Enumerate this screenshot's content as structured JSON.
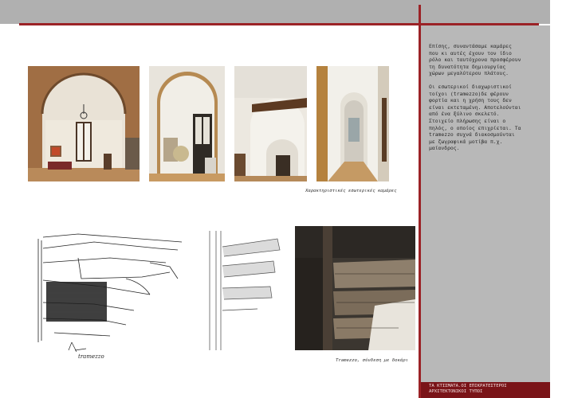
{
  "sidebar": {
    "paragraph1": "Επίσης, συναντάσαμε καμάρες\nπου κι αυτές έχουν τον ίδιο\nρόλο και ταυτόχρονα προσφέρουν\nτη δυνατότητα δημιουργίας\nχώρων μεγαλύτερου πλάτους.",
    "paragraph2": "Οι εσωτερικοί διαχωριστικοί\nτοίχοι (tramezzo)δε φέρουν\nφορτία και η χρήση τους δεν\nείναι εκτεταμένη. Αποτελούνται\nαπό ένα ξύλινο σκελετό.\nΣτοιχείο πλήρωσης είναι ο\nπηλός, ο οποίος επιχρίεται. Τα\ntramezzo συχνά διακοσμούνται\nμε ζωγραφικά μοτίβα π.χ.\nμαίανδρος.",
    "footer": "ΤΑ ΚΤΙΣΜΑΤΑ.ΟΙ ΕΠΙΚΡΑΤΕΣΤΕΡΟΙ\nΑΡΧΙΤΕΚΤΟΝΙΚΟΙ ΤΥΠΟΙ"
  },
  "captions": {
    "arches": "Χαρακτηριστικές εσωτερικές καμάρες",
    "tramezzo": "Tramezzo, σύνδεση με δοκάρι"
  },
  "sketch": {
    "annotation": "tramezzo"
  },
  "colors": {
    "accent": "#9b2226",
    "sidebar": "#b8b8b8",
    "footer": "#7a1418"
  }
}
